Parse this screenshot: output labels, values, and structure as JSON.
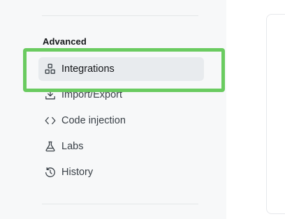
{
  "sidebar": {
    "section_title": "Advanced",
    "items": [
      {
        "label": "Integrations",
        "icon": "integrations-icon",
        "active": true
      },
      {
        "label": "Import/Export",
        "icon": "download-icon",
        "active": false
      },
      {
        "label": "Code injection",
        "icon": "code-icon",
        "active": false
      },
      {
        "label": "Labs",
        "icon": "flask-icon",
        "active": false
      },
      {
        "label": "History",
        "icon": "history-icon",
        "active": false
      }
    ]
  },
  "colors": {
    "highlight": "#6acb60",
    "active_bg": "#e8ebee",
    "text": "#394047"
  }
}
